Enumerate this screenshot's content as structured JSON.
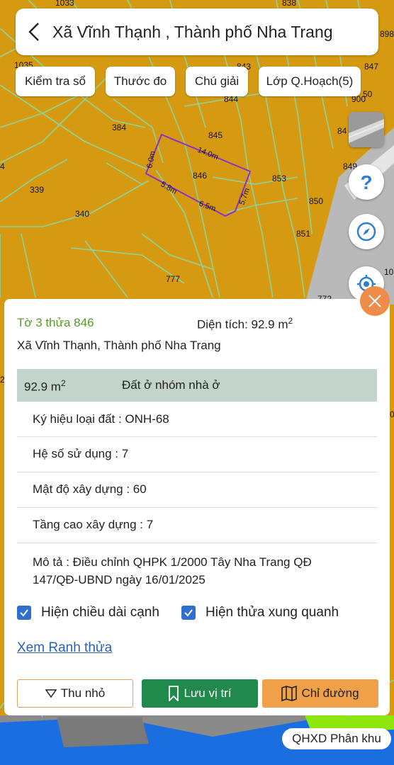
{
  "header": {
    "title": "Xã Vĩnh Thạnh , Thành phố Nha Trang"
  },
  "toolbar": {
    "buttons": [
      "Kiểm tra sổ",
      "Thước đo",
      "Chú giải",
      "Lớp Q.Hoạch(5)"
    ]
  },
  "map": {
    "parcel_numbers": [
      "1033",
      "838",
      "898",
      "1035",
      "843",
      "847",
      "844",
      "900",
      "50",
      "384",
      "845",
      "84",
      "4",
      "849",
      "846",
      "853",
      "339",
      "850",
      "340",
      "851",
      "777",
      "10",
      "772",
      "2",
      "0"
    ],
    "edge_lengths": [
      "6.0m",
      "14.0m",
      "5.8m",
      "6.5m",
      "5.7m"
    ],
    "colors": {
      "residential": "#d69a12",
      "boundary": "#8cd49a",
      "selected_parcel": "#8b2fc9",
      "road": "#bfbfbf",
      "water": "#1a6ee0",
      "green": "#8ee60f"
    }
  },
  "info": {
    "plot_name": "Tờ 3 thửa 846",
    "area_label": "Diện tích: 92.9 m",
    "area_sup": "2",
    "address": "Xã Vĩnh Thạnh, Thành phố Nha Trang",
    "land": {
      "area": "92.9 m",
      "area_sup": "2",
      "type": "Đất ở nhóm nhà ở"
    },
    "attributes": [
      "Ký hiệu loại đất : ONH-68",
      "Hệ số sử dụng : 7",
      "Mật độ xây dựng : 60",
      "Tầng cao xây dựng : 7"
    ],
    "description_lines": [
      "Mô tả : Điều chỉnh QHPK 1/2000 Tây Nha Trang QĐ",
      "147/QĐ-UBND ngày 16/01/2025"
    ],
    "checkboxes": [
      "Hiện chiều dài cạnh",
      "Hiện thửa xung quanh"
    ],
    "link": "Xem Ranh thửa",
    "buttons": {
      "collapse": "Thu nhỏ",
      "save": "Lưu vị trí",
      "directions": "Chỉ đường"
    }
  },
  "layer_badge": "QHXD Phân khu",
  "icons": [
    "back-arrow-icon",
    "layers-icon",
    "help-icon",
    "compass-icon",
    "locate-icon",
    "close-icon",
    "caret-down-icon",
    "bookmark-icon",
    "map-icon",
    "checkmark-icon"
  ],
  "accent_colors": {
    "green": "#1f8a4c",
    "orange": "#f0a048",
    "blue": "#2f6fd0",
    "close": "#ef8c49"
  }
}
